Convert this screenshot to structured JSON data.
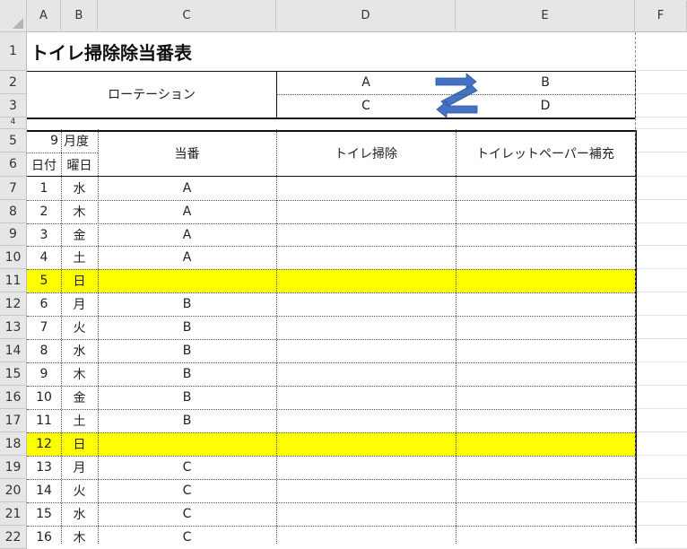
{
  "columns": [
    "A",
    "B",
    "C",
    "D",
    "E",
    "F"
  ],
  "rows": [
    "1",
    "2",
    "3",
    "4",
    "5",
    "6",
    "7",
    "8",
    "9",
    "10",
    "11",
    "12",
    "13",
    "14",
    "15",
    "16",
    "17",
    "18",
    "19",
    "20",
    "21",
    "22"
  ],
  "sheet": {
    "title": "トイレ掃除除当番表",
    "rotation": {
      "label": "ローテーション",
      "cells": [
        "A",
        "B",
        "C",
        "D"
      ]
    },
    "month_number": "9",
    "month_suffix": "月度",
    "headers": {
      "date": "日付",
      "weekday": "曜日",
      "duty": "当番",
      "toilet_cleaning": "トイレ掃除",
      "paper_refill": "トイレットペーパー補充"
    },
    "data_rows": [
      {
        "day": "1",
        "weekday": "水",
        "duty": "A",
        "highlight": false
      },
      {
        "day": "2",
        "weekday": "木",
        "duty": "A",
        "highlight": false
      },
      {
        "day": "3",
        "weekday": "金",
        "duty": "A",
        "highlight": false
      },
      {
        "day": "4",
        "weekday": "土",
        "duty": "A",
        "highlight": false
      },
      {
        "day": "5",
        "weekday": "日",
        "duty": "",
        "highlight": true
      },
      {
        "day": "6",
        "weekday": "月",
        "duty": "B",
        "highlight": false
      },
      {
        "day": "7",
        "weekday": "火",
        "duty": "B",
        "highlight": false
      },
      {
        "day": "8",
        "weekday": "水",
        "duty": "B",
        "highlight": false
      },
      {
        "day": "9",
        "weekday": "木",
        "duty": "B",
        "highlight": false
      },
      {
        "day": "10",
        "weekday": "金",
        "duty": "B",
        "highlight": false
      },
      {
        "day": "11",
        "weekday": "土",
        "duty": "B",
        "highlight": false
      },
      {
        "day": "12",
        "weekday": "日",
        "duty": "",
        "highlight": true
      },
      {
        "day": "13",
        "weekday": "月",
        "duty": "C",
        "highlight": false
      },
      {
        "day": "14",
        "weekday": "火",
        "duty": "C",
        "highlight": false
      },
      {
        "day": "15",
        "weekday": "水",
        "duty": "C",
        "highlight": false
      },
      {
        "day": "16",
        "weekday": "木",
        "duty": "C",
        "highlight": false
      }
    ]
  },
  "colors": {
    "highlight": "#ffff00",
    "arrow": "#4472c4",
    "header_bg": "#e6e6e6"
  }
}
